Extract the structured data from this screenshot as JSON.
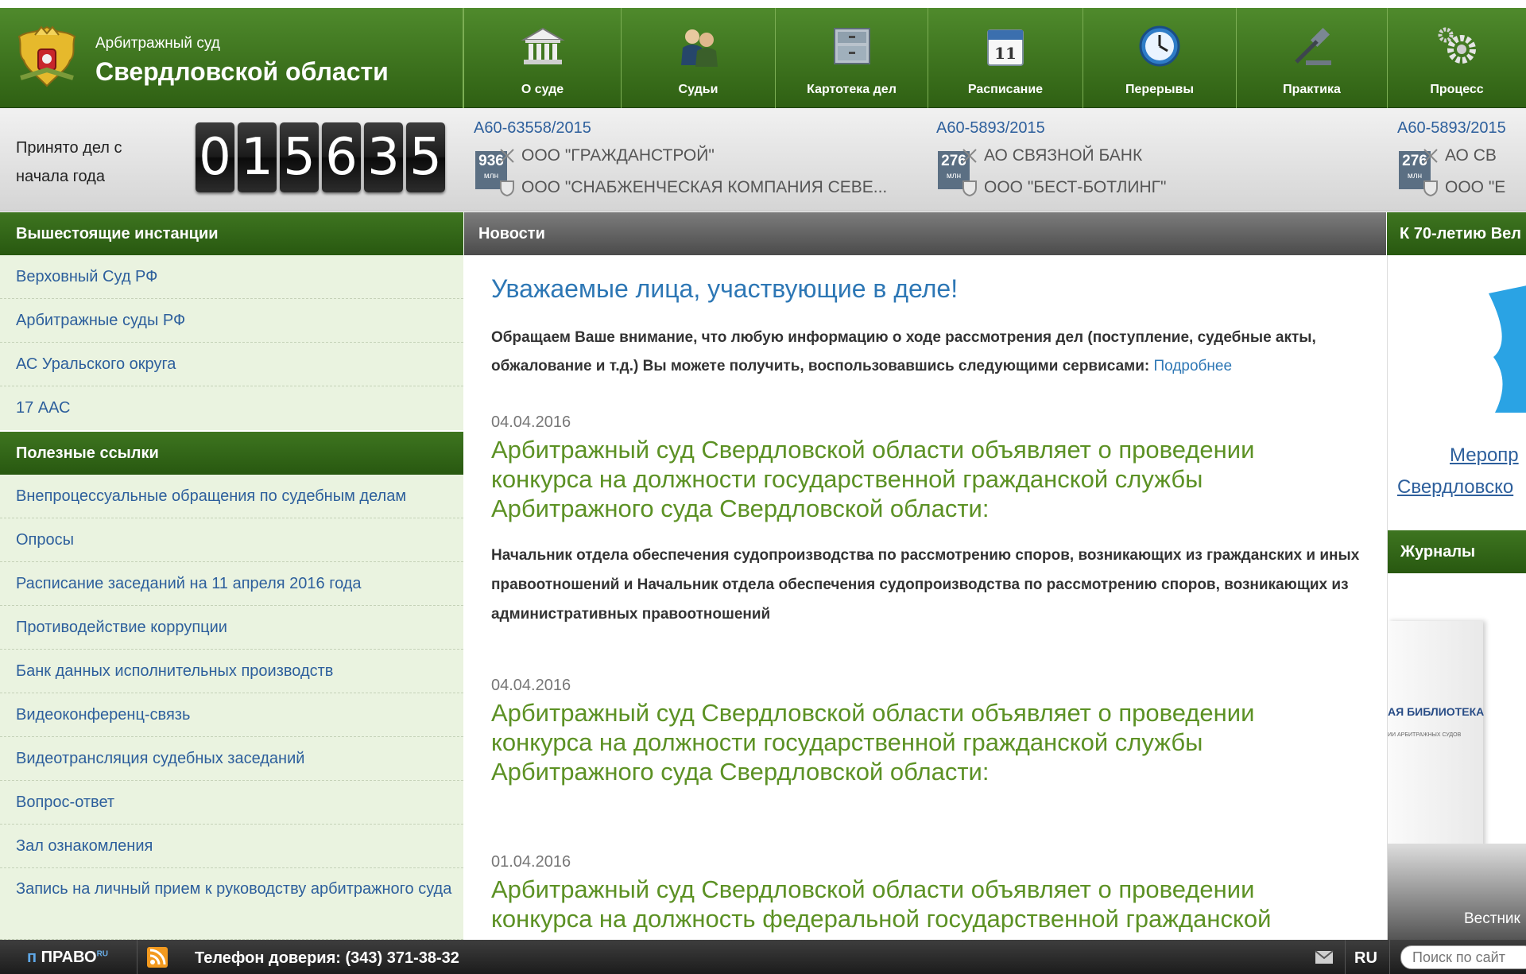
{
  "header": {
    "court_line1": "Арбитражный суд",
    "court_line2": "Свердловской области",
    "nav": [
      {
        "label": "О суде",
        "icon": "building-icon"
      },
      {
        "label": "Судьи",
        "icon": "judges-icon"
      },
      {
        "label": "Картотека дел",
        "icon": "cabinet-icon"
      },
      {
        "label": "Расписание",
        "icon": "calendar-icon",
        "day": "11"
      },
      {
        "label": "Перерывы",
        "icon": "clock-icon"
      },
      {
        "label": "Практика",
        "icon": "gavel-icon"
      },
      {
        "label": "Процесс",
        "icon": "gears-icon"
      }
    ]
  },
  "counter": {
    "label": "Принято дел с начала года",
    "digits": [
      "0",
      "1",
      "5",
      "6",
      "3",
      "5"
    ]
  },
  "cases": [
    {
      "number": "А60-63558/2015",
      "amount": "936",
      "unit": "млн",
      "plaintiff": "ООО \"ГРАЖДАНСТРОЙ\"",
      "defendant": "ООО \"СНАБЖЕНЧЕСКАЯ КОМПАНИЯ СЕВЕ..."
    },
    {
      "number": "А60-5893/2015",
      "amount": "276",
      "unit": "млн",
      "plaintiff": "АО СВЯЗНОЙ БАНК",
      "defendant": "ООО \"БЕСТ-БОТЛИНГ\""
    },
    {
      "number": "А60-5893/2015",
      "amount": "276",
      "unit": "млн",
      "plaintiff": "АО СВ",
      "defendant": "ООО \"Е"
    }
  ],
  "sidebar": {
    "section1_title": "Вышестоящие инстанции",
    "section1_items": [
      "Верховный Суд РФ",
      "Арбитражные суды РФ",
      "АС Уральского округа",
      "17 ААС"
    ],
    "section2_title": "Полезные ссылки",
    "section2_items": [
      "Внепроцессуальные обращения по судебным делам",
      "Опросы",
      "Расписание заседаний на 11 апреля 2016 года",
      "Противодействие коррупции",
      "Банк данных исполнительных производств",
      "Видеоконференц-связь",
      "Видеотрансляция судебных заседаний",
      "Вопрос-ответ",
      "Зал ознакомления",
      "Запись на личный прием к руководству арбитражного суда"
    ]
  },
  "news": {
    "header": "Новости",
    "notice_title": "Уважаемые лица, участвующие в деле!",
    "notice_text": "Обращаем Ваше внимание, что любую информацию о ходе рассмотрения дел (поступление, судебные акты, обжалование и т.д.) Вы можете получить, воспользовавшись следующими сервисами:",
    "notice_link": "Подробнее",
    "items": [
      {
        "date": "04.04.2016",
        "title": "Арбитражный суд Свердловской области объявляет о проведении конкурса на должности государственной гражданской службы Арбитражного суда Свердловской области:",
        "body": "Начальник отдела обеспечения судопроизводства по рассмотрению споров, возникающих из гражданских и иных правоотношений и  Начальник отдела обеспечения судопроизводства по рассмотрению споров, возникающих из административных правоотношений"
      },
      {
        "date": "04.04.2016",
        "title": "Арбитражный суд Свердловской области объявляет о проведении конкурса на должности государственной гражданской службы Арбитражного суда Свердловской области:",
        "body": ""
      },
      {
        "date": "01.04.2016",
        "title": "Арбитражный суд Свердловской области объявляет о проведении конкурса на должность федеральной государственной гражданской",
        "body": ""
      }
    ]
  },
  "right": {
    "anniversary_header": "К 70-летию Вел",
    "event_line1": "Меропр",
    "event_line2": "Свердловско",
    "journals_header": "Журналы",
    "book_text": "АЯ БИБЛИОТЕКА",
    "book_subtext": "ИИ АРБИТРАЖНЫХ СУДОВ",
    "journal_caption": "Вестник"
  },
  "footer": {
    "logo": "ПРАВО",
    "logo_sup": "RU",
    "phone": "Телефон доверия: (343) 371-38-32",
    "lang": "RU",
    "search_placeholder": "Поиск по сайт"
  },
  "colors": {
    "header_green": "#3f7a1f",
    "link_blue": "#2d5f9c",
    "news_green": "#5c9124",
    "sidebar_bg": "#eaf3e0"
  }
}
